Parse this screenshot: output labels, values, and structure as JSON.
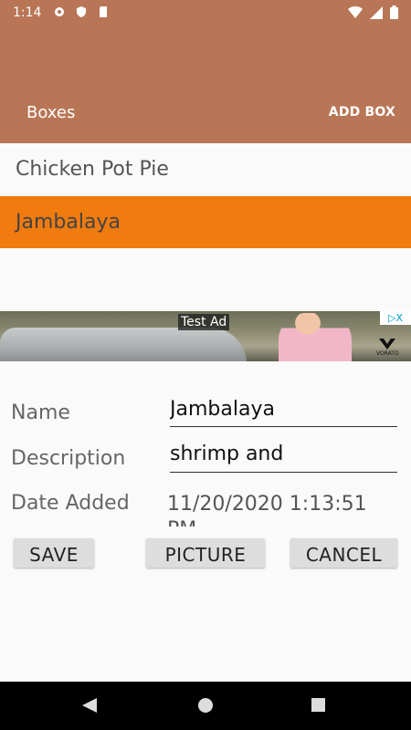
{
  "status_bar": {
    "time": "1:14",
    "icons": [
      "gear-icon",
      "shield-icon",
      "sd-card-icon",
      "wifi-icon",
      "signal-icon",
      "battery-icon"
    ]
  },
  "appbar": {
    "title": "Boxes",
    "add_box": "ADD BOX",
    "color": "#b87656"
  },
  "list": {
    "items": [
      {
        "label": "Chicken Pot Pie",
        "selected": false
      },
      {
        "label": "Jambalaya",
        "selected": true
      }
    ],
    "selected_color": "#f07b0e"
  },
  "ad": {
    "label": "Test Ad",
    "adchoices": "▷X",
    "logo_text": "VORATO"
  },
  "form": {
    "name_label": "Name",
    "name_value": "Jambalaya",
    "description_label": "Description",
    "description_value": "shrimp and",
    "date_label": "Date Added",
    "date_value": "11/20/2020 1:13:51",
    "date_value_wrap": "PM"
  },
  "buttons": {
    "save": "SAVE",
    "picture": "PICTURE",
    "cancel": "CANCEL"
  }
}
